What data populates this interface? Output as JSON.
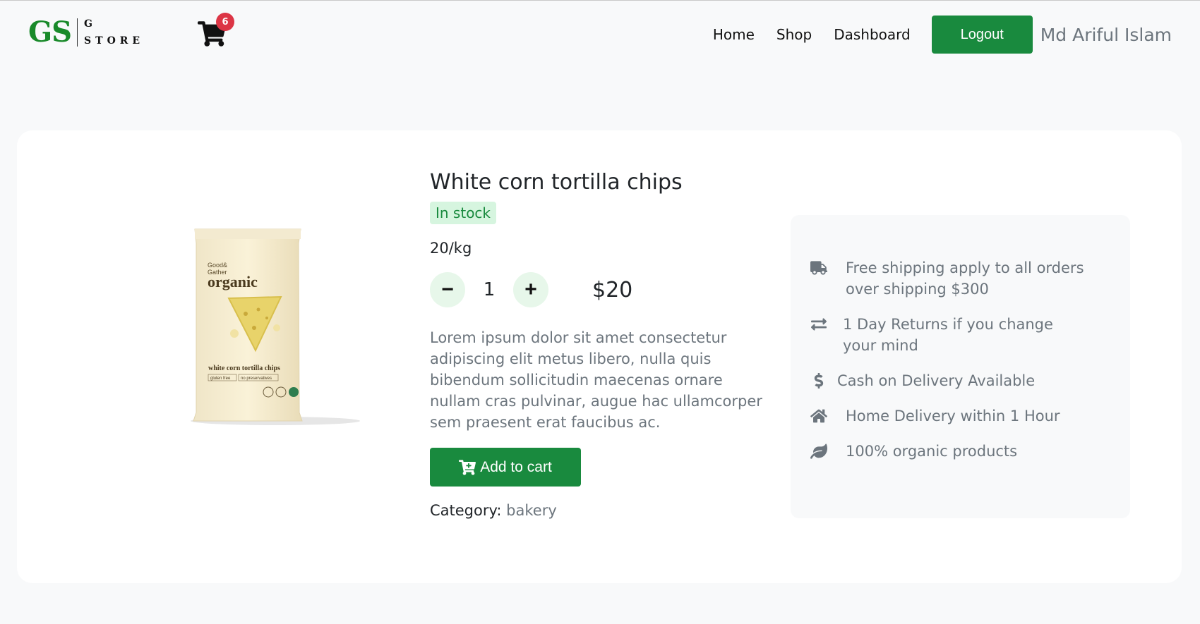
{
  "brand": {
    "logo_mark": "GS",
    "logo_line1": "G",
    "logo_line2": "STORE",
    "color": "#198a2a"
  },
  "cart": {
    "icon": "cart-icon",
    "count": "6",
    "badge_color": "#dc3545"
  },
  "nav": {
    "links": [
      "Home",
      "Shop",
      "Dashboard"
    ],
    "logout_label": "Logout",
    "user_name": "Md Ariful Islam"
  },
  "product": {
    "title": "White corn tortilla chips",
    "stock_status": "In stock",
    "unit": "20/kg",
    "quantity": "1",
    "decrement_label": "−",
    "increment_label": "+",
    "price": "$20",
    "description": "Lorem ipsum dolor sit amet consectetur adipiscing elit metus libero, nulla quis bibendum sollicitudin maecenas ornare nullam cras pulvinar, augue hac ullamcorper sem praesent erat faucibus ac.",
    "add_to_cart_label": "Add to cart",
    "category_label": "Category:",
    "category_value": "bakery",
    "image": {
      "brand_small": "Good&",
      "brand_small2": "Gather",
      "brand_large": "organic",
      "name": "white corn tortilla chips",
      "tag1": "gluten free",
      "tag2": "no preservatives"
    }
  },
  "features": [
    {
      "icon": "truck-icon",
      "text": "Free shipping apply to all orders over shipping $300"
    },
    {
      "icon": "exchange-icon",
      "text": "1 Day Returns if you change your mind"
    },
    {
      "icon": "dollar-icon",
      "text": "Cash on Delivery Available"
    },
    {
      "icon": "home-icon",
      "text": "Home Delivery within 1 Hour"
    },
    {
      "icon": "leaf-icon",
      "text": "100% organic products"
    }
  ],
  "colors": {
    "accent": "#198a3e",
    "stock_bg": "#d6f5df",
    "muted": "#6c757d"
  }
}
